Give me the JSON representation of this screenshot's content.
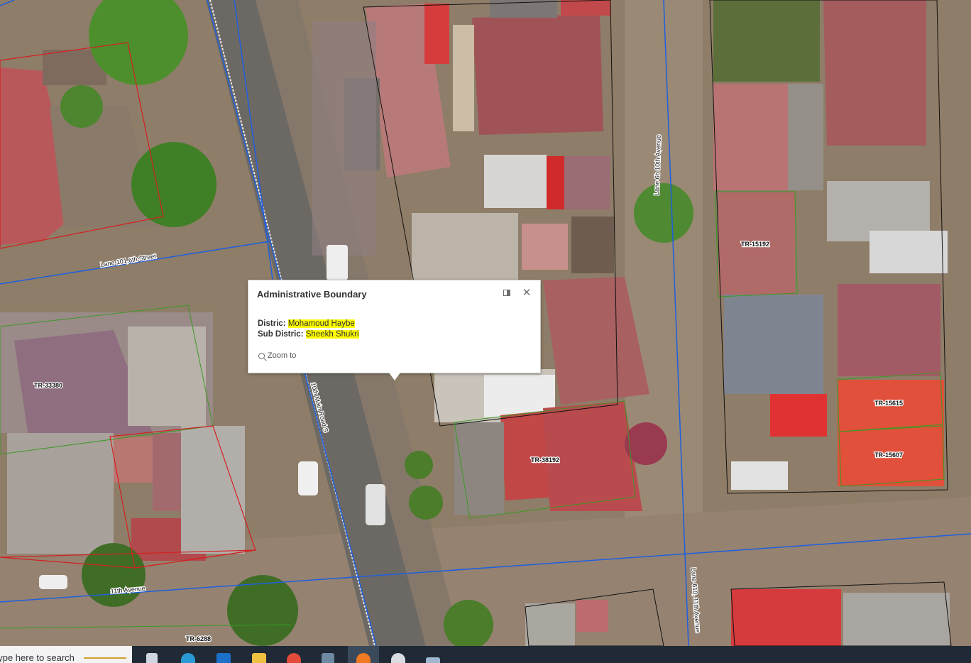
{
  "popup": {
    "title": "Administrative Boundary",
    "fields": [
      {
        "label": "Distric:",
        "value": "Mohamoud Haybe",
        "highlight": true
      },
      {
        "label": "Sub Distric:",
        "value": "Sheekh Shukri",
        "highlight": true
      }
    ],
    "zoom_label": "Zoom to",
    "dock_icon": "dock-icon",
    "close_icon": "close-icon",
    "highlight_color": "#ffff00"
  },
  "map": {
    "road_labels": [
      "Lane 101,6th Street",
      "10th Main Road S",
      "Lane 6b 10th Avenue",
      "11th Avenue",
      "Lane 610, 11th Avenue"
    ],
    "parcel_labels": [
      "TR-15192",
      "TR-33380",
      "TR-38192",
      "TR-15615",
      "TR-15607",
      "TR-6288"
    ],
    "colors": {
      "road_boundary": "#1f5fe0",
      "parcel_green": "#3a9a24",
      "parcel_red": "#d42020",
      "parcel_black": "#111111"
    }
  },
  "taskbar": {
    "search_placeholder": "Type here to search",
    "icons": [
      "cortana-icon",
      "task-view-icon",
      "edge-icon",
      "mail-icon",
      "file-explorer-icon",
      "chrome-icon",
      "calculator-icon",
      "firefox-icon",
      "paint-icon",
      "snip-icon"
    ]
  }
}
